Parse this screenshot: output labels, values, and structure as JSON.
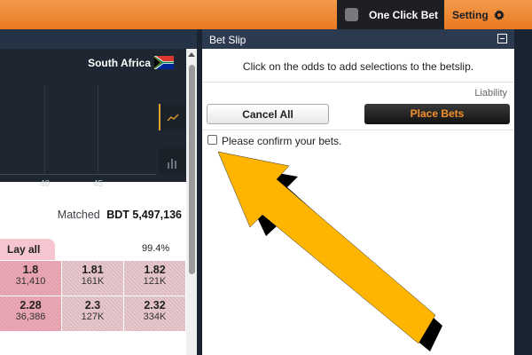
{
  "header": {
    "one_click_bet_label": "One Click Bet",
    "setting_label": "Setting",
    "setting_icon": "gear-icon"
  },
  "market": {
    "country": "South Africa",
    "chart_ticks": [
      "40",
      "45"
    ],
    "matched_label": "Matched",
    "matched_amount": "BDT 5,497,136",
    "lay_all_label": "Lay all",
    "overround": "99.4%",
    "odds_rows": [
      [
        {
          "price": "1.8",
          "volume": "31,410"
        },
        {
          "price": "1.81",
          "volume": "161K"
        },
        {
          "price": "1.82",
          "volume": "121K"
        }
      ],
      [
        {
          "price": "2.28",
          "volume": "36,386"
        },
        {
          "price": "2.3",
          "volume": "127K"
        },
        {
          "price": "2.32",
          "volume": "334K"
        }
      ]
    ]
  },
  "bet_slip": {
    "title": "Bet Slip",
    "hint": "Click on the odds to add selections to the betslip.",
    "liability_label": "Liability",
    "cancel_all_label": "Cancel All",
    "place_bets_label": "Place Bets",
    "confirm_label": "Please confirm your bets.",
    "confirm_checked": false
  },
  "colors": {
    "topbar_orange": "#e97a22",
    "arrow_fill": "#ffb400",
    "lay_pink": "#f5c6cf",
    "place_bets_text": "#f39128"
  }
}
